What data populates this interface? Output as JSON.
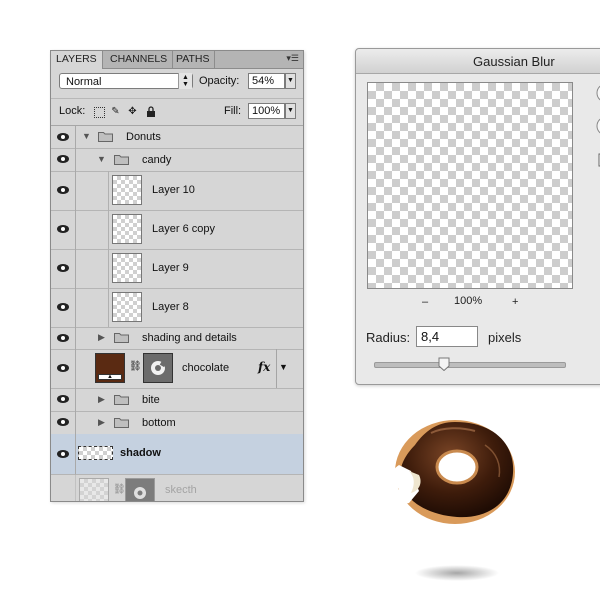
{
  "layers_panel": {
    "tabs": [
      "LAYERS",
      "CHANNELS",
      "PATHS"
    ],
    "blend_mode": "Normal",
    "opacity_label": "Opacity:",
    "opacity_value": "54%",
    "lock_label": "Lock:",
    "fill_label": "Fill:",
    "fill_value": "100%",
    "layers": [
      {
        "name": "Donuts",
        "type": "group",
        "level": 0,
        "expanded": true
      },
      {
        "name": "candy",
        "type": "group",
        "level": 1,
        "expanded": true
      },
      {
        "name": "Layer 10",
        "type": "layer",
        "level": 2
      },
      {
        "name": "Layer 6 copy",
        "type": "layer",
        "level": 2
      },
      {
        "name": "Layer 9",
        "type": "layer",
        "level": 2
      },
      {
        "name": "Layer 8",
        "type": "layer",
        "level": 2
      },
      {
        "name": "shading and details",
        "type": "group",
        "level": 1,
        "expanded": false
      },
      {
        "name": "chocolate",
        "type": "layer-mask",
        "level": 1,
        "has_fx": true,
        "fx_label": "fx"
      },
      {
        "name": "bite",
        "type": "group",
        "level": 1,
        "expanded": false
      },
      {
        "name": "bottom",
        "type": "group",
        "level": 1,
        "expanded": false
      },
      {
        "name": "shadow",
        "type": "layer",
        "level": 0,
        "selected": true
      },
      {
        "name": "skecth",
        "type": "layer-mask",
        "level": 0,
        "faded": true
      }
    ]
  },
  "gaussian_blur": {
    "title": "Gaussian Blur",
    "zoom_out": "–",
    "zoom_value": "100%",
    "zoom_in": "+",
    "radius_label": "Radius:",
    "radius_value": "8,4",
    "unit": "pixels",
    "slider_fraction": 0.37
  },
  "colors": {
    "panel_bg": "#d6d6d6",
    "selection": "#c5d1e0",
    "chocolate_swatch": "#5a2a12"
  }
}
